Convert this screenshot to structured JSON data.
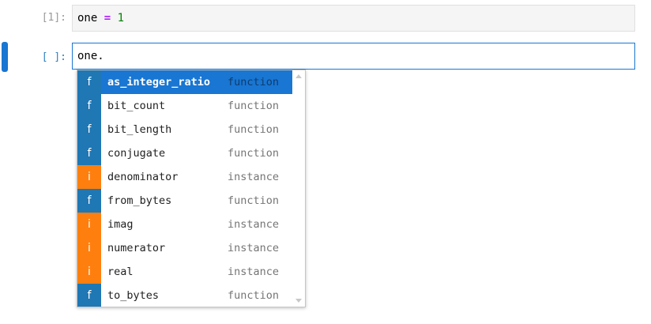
{
  "cells": [
    {
      "prompt": "[1]:",
      "code": {
        "var": "one",
        "op": "=",
        "num": "1"
      }
    },
    {
      "prompt": "[ ]:",
      "code": "one."
    }
  ],
  "completer": {
    "items": [
      {
        "badge": "f",
        "name": "as_integer_ratio",
        "type": "function",
        "selected": true
      },
      {
        "badge": "f",
        "name": "bit_count",
        "type": "function"
      },
      {
        "badge": "f",
        "name": "bit_length",
        "type": "function"
      },
      {
        "badge": "f",
        "name": "conjugate",
        "type": "function"
      },
      {
        "badge": "i",
        "name": "denominator",
        "type": "instance"
      },
      {
        "badge": "f",
        "name": "from_bytes",
        "type": "function"
      },
      {
        "badge": "i",
        "name": "imag",
        "type": "instance"
      },
      {
        "badge": "i",
        "name": "numerator",
        "type": "instance"
      },
      {
        "badge": "i",
        "name": "real",
        "type": "instance"
      },
      {
        "badge": "f",
        "name": "to_bytes",
        "type": "function"
      }
    ]
  },
  "colors": {
    "function": "#1f77b4",
    "instance": "#ff7f0e",
    "selection": "#1976d2"
  }
}
